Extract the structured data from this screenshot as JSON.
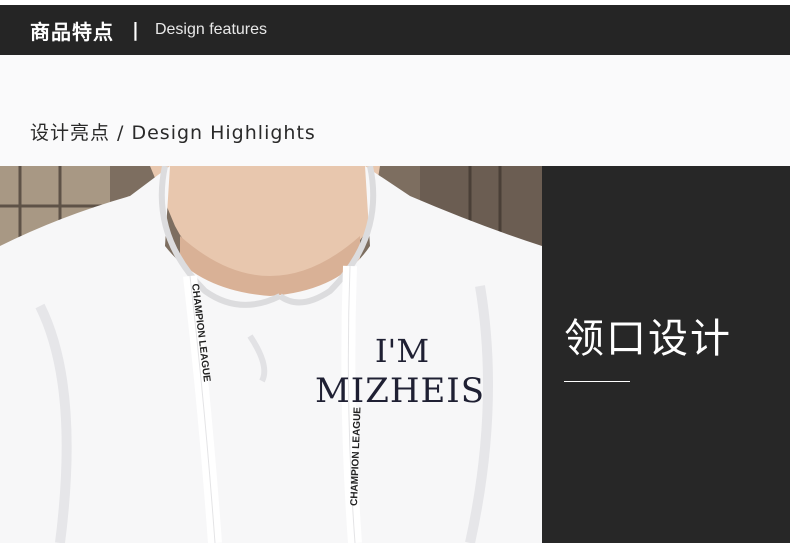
{
  "header": {
    "title": "商品特点",
    "separator": "|",
    "subtitle": "Design features"
  },
  "section": {
    "title": "设计亮点 / Design Highlights"
  },
  "photo": {
    "shirt_text_line1": "I'M",
    "shirt_text_line2": "MIZHEIS",
    "drawstring_text_left": "CHAMPION LEAGUE",
    "drawstring_text_right": "CHAMPION LEAGUE"
  },
  "panel": {
    "title": "领口设计"
  },
  "colors": {
    "header_bg": "#252525",
    "panel_bg": "#272727",
    "hoodie": "#f7f7f8",
    "text_dark": "#2a2a2a"
  }
}
